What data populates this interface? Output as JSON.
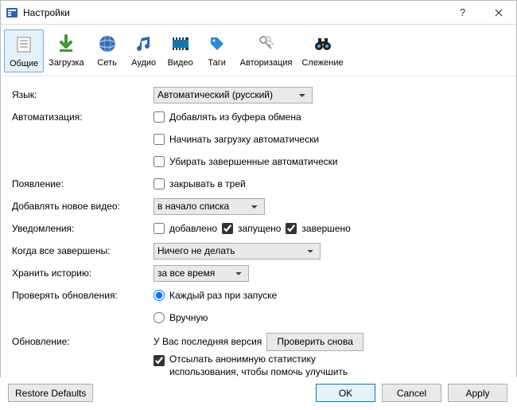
{
  "window": {
    "title": "Настройки"
  },
  "toolbar": {
    "items": [
      {
        "label": "Общие"
      },
      {
        "label": "Загрузка"
      },
      {
        "label": "Сеть"
      },
      {
        "label": "Аудио"
      },
      {
        "label": "Видео"
      },
      {
        "label": "Таги"
      },
      {
        "label": "Авторизация"
      },
      {
        "label": "Слежение"
      }
    ]
  },
  "labels": {
    "language": "Язык:",
    "automation": "Автоматизация:",
    "appearance": "Появление:",
    "add_new_video": "Добавлять новое видео:",
    "notifications": "Уведомления:",
    "when_all_done": "Когда все завершены:",
    "keep_history": "Хранить историю:",
    "check_updates": "Проверять обновления:",
    "update": "Обновление:"
  },
  "language": {
    "value": "Автоматический (русский)"
  },
  "automation": {
    "clipboard": "Добавлять из буфера обмена",
    "autostart": "Начинать загрузку автоматически",
    "autoclean": "Убирать завершенные автоматически"
  },
  "appearance": {
    "close_to_tray": "закрывать в трей"
  },
  "add_video": {
    "value": "в начало списка"
  },
  "notifications": {
    "added": "добавлено",
    "started": "запущено",
    "finished": "завершено"
  },
  "when_done": {
    "value": "Ничего не делать"
  },
  "history": {
    "value": "за все время"
  },
  "updates": {
    "each_start": "Каждый раз при запуске",
    "manual": "Вручную"
  },
  "update_info": {
    "status": "У Вас последняя версия",
    "check_again": "Проверить снова",
    "stats": "Отсылать анонимную статистику использования, чтобы помочь улучшить программу"
  },
  "footer": {
    "restore": "Restore Defaults",
    "ok": "OK",
    "cancel": "Cancel",
    "apply": "Apply"
  }
}
